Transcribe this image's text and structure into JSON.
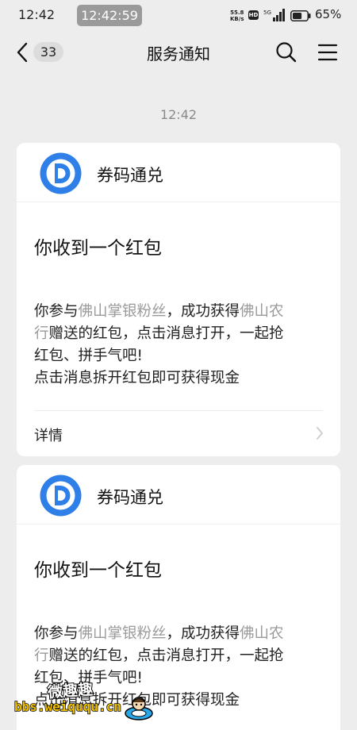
{
  "status_bar": {
    "time": "12:42",
    "pill_time": "12:42:59",
    "speed_value": "55.8",
    "speed_unit": "KB/s",
    "hd_badge": "HD",
    "network_label": "5G",
    "battery_percent": "65%",
    "battery_level": 0.65
  },
  "nav": {
    "back_icon": "chevron-left-icon",
    "unread_count": "33",
    "title": "服务通知",
    "search_icon": "search-icon",
    "menu_icon": "menu-icon"
  },
  "conversation": {
    "timestamp": "12:42"
  },
  "notifications": [
    {
      "app_name": "券码通兑",
      "title": "你收到一个红包",
      "body": {
        "line1_prefix": "你参与",
        "line1_highlight": "佛山掌银粉丝",
        "line1_mid": "，成功获得",
        "line1_highlight2": "佛山农",
        "line2_highlight": "行",
        "line2_rest": "赠送的红包，点击消息打开，一起抢",
        "line3": "红包、拼手气吧!",
        "line4": "点击消息拆开红包即可获得现金"
      },
      "details_label": "详情"
    },
    {
      "app_name": "券码通兑",
      "title": "你收到一个红包",
      "body": {
        "line1_prefix": "你参与",
        "line1_highlight": "佛山掌银粉丝",
        "line1_mid": "，成功获得",
        "line1_highlight2": "佛山农",
        "line2_highlight": "行",
        "line2_rest": "赠送的红包，点击消息打开，一起抢",
        "line3": "红包、拼手气吧!",
        "line4": "点击消息拆开红包即可获得现金"
      }
    }
  ],
  "watermark": {
    "top_text": "微趣趣",
    "bottom_text": "bbs.weiququ.cn"
  },
  "colors": {
    "background": "#ededed",
    "card": "#ffffff",
    "highlight_text": "#9a9a9a",
    "logo_blue": "#2f7fe8"
  }
}
